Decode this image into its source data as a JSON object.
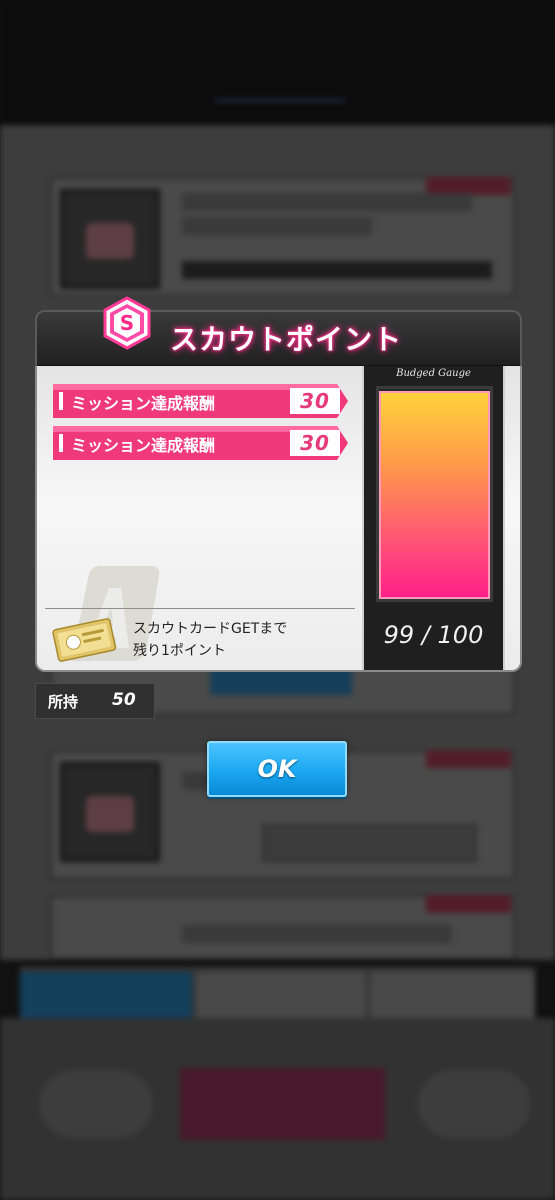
{
  "dialog": {
    "badge_letter": "S",
    "title": "スカウトポイント",
    "rewards": [
      {
        "label": "ミッション達成報酬",
        "value": "30"
      },
      {
        "label": "ミッション達成報酬",
        "value": "30"
      }
    ],
    "scout_card": {
      "line1": "スカウトカードGETまで",
      "line2": "残り1ポイント"
    },
    "gauge": {
      "caption": "Budged Gauge",
      "current": 99,
      "max": 100,
      "readout": "99 / 100",
      "fill_fraction": 0.99
    }
  },
  "owned": {
    "label": "所持",
    "value": "50"
  },
  "ok_button": {
    "label": "OK"
  },
  "colors": {
    "accent_pink": "#e63a7a",
    "ok_blue": "#1aa8f2",
    "gauge_top": "#ffd23a",
    "gauge_bottom": "#ff1f89"
  }
}
